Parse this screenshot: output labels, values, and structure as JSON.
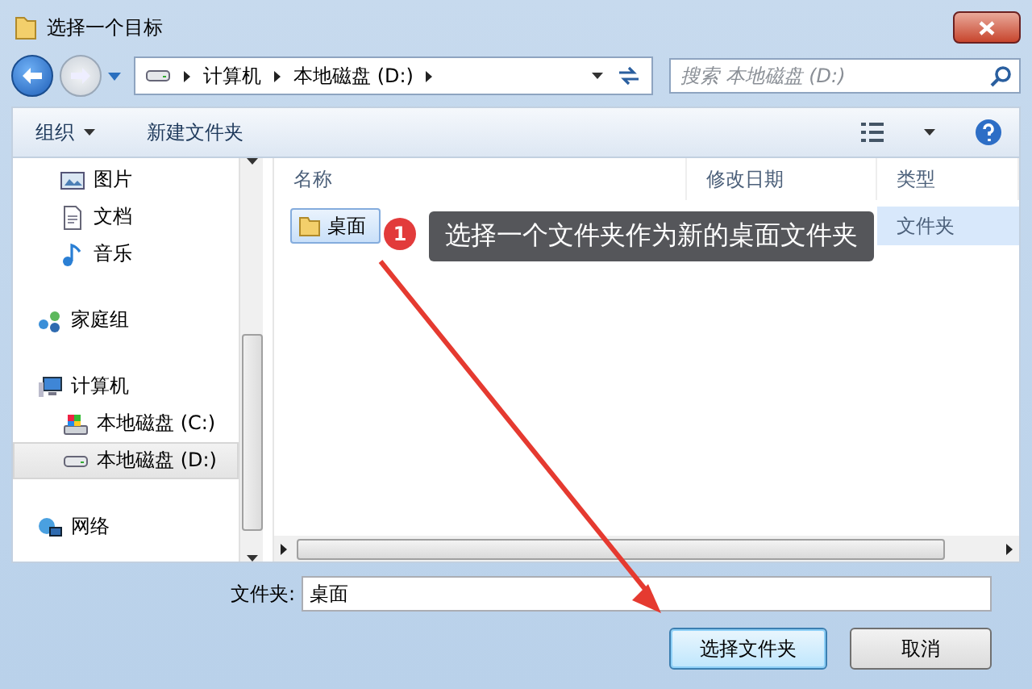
{
  "window": {
    "title": "选择一个目标"
  },
  "address": {
    "crumbs": [
      "计算机",
      "本地磁盘 (D:)"
    ],
    "search_placeholder": "搜索 本地磁盘 (D:)"
  },
  "toolbar": {
    "buttons": [
      {
        "label": "组织",
        "dropdown": true
      },
      {
        "label": "新建文件夹",
        "dropdown": false
      }
    ]
  },
  "sidebar": {
    "groups": [
      {
        "items": [
          {
            "label": "图片",
            "kind": "picture",
            "selected": false
          },
          {
            "label": "文档",
            "kind": "document",
            "selected": false
          },
          {
            "label": "音乐",
            "kind": "music",
            "selected": false
          }
        ]
      },
      {
        "items": [
          {
            "label": "家庭组",
            "kind": "homegroup",
            "selected": false
          }
        ]
      },
      {
        "items": [
          {
            "label": "计算机",
            "kind": "computer",
            "selected": false,
            "children": [
              {
                "label": "本地磁盘 (C:)",
                "kind": "system",
                "selected": false
              },
              {
                "label": "本地磁盘 (D:)",
                "kind": "drive",
                "selected": true
              }
            ]
          }
        ]
      },
      {
        "items": [
          {
            "label": "网络",
            "kind": "network",
            "selected": false
          }
        ]
      }
    ]
  },
  "file_list": {
    "columns": [
      "名称",
      "修改日期",
      "类型"
    ],
    "rows": [
      {
        "name": "桌面",
        "type": "文件夹",
        "selected": true
      }
    ]
  },
  "annotation": {
    "number": "1",
    "text": "选择一个文件夹作为新的桌面文件夹"
  },
  "footer": {
    "field_label": "文件夹:",
    "field_value": "桌面",
    "buttons": [
      {
        "label": "选择文件夹",
        "default": true
      },
      {
        "label": "取消",
        "default": false
      }
    ]
  }
}
